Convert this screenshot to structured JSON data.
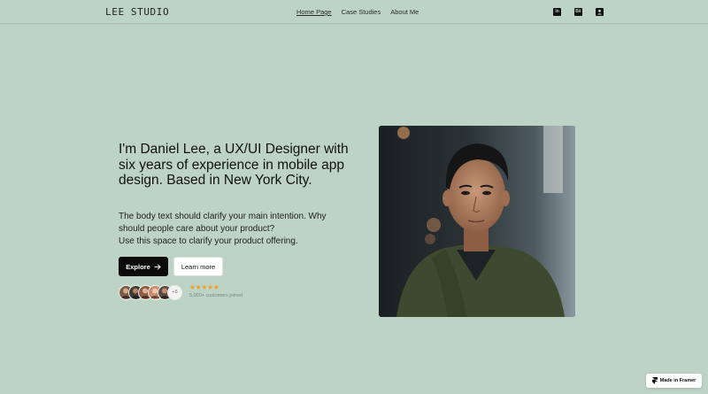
{
  "header": {
    "logo": "LEE STUDIO",
    "nav": [
      {
        "label": "Home Page",
        "active": true
      },
      {
        "label": "Case Studies",
        "active": false
      },
      {
        "label": "About Me",
        "active": false
      }
    ],
    "social_icons": [
      "linkedin-icon",
      "behance-icon",
      "contact-icon"
    ]
  },
  "hero": {
    "title": "I'm Daniel Lee, a UX/UI Designer with six years of experience in mobile app design. Based in New York City.",
    "body_line1": "The body text should clarify your main intention. Why",
    "body_line2": "should people care about your product?",
    "body_line3": " Use this space to clarify your product offering.",
    "explore_label": "Explore",
    "learn_label": "Learn more",
    "more_customers": "+5",
    "rating_stars": "★★★★★",
    "rating": 5,
    "customers_joined": "5,000+ customers joined"
  },
  "badge": {
    "label": "Made in Framer"
  },
  "colors": {
    "background": "#bcd3c5",
    "button_primary": "#0b0b0b",
    "star": "#f0a020"
  }
}
